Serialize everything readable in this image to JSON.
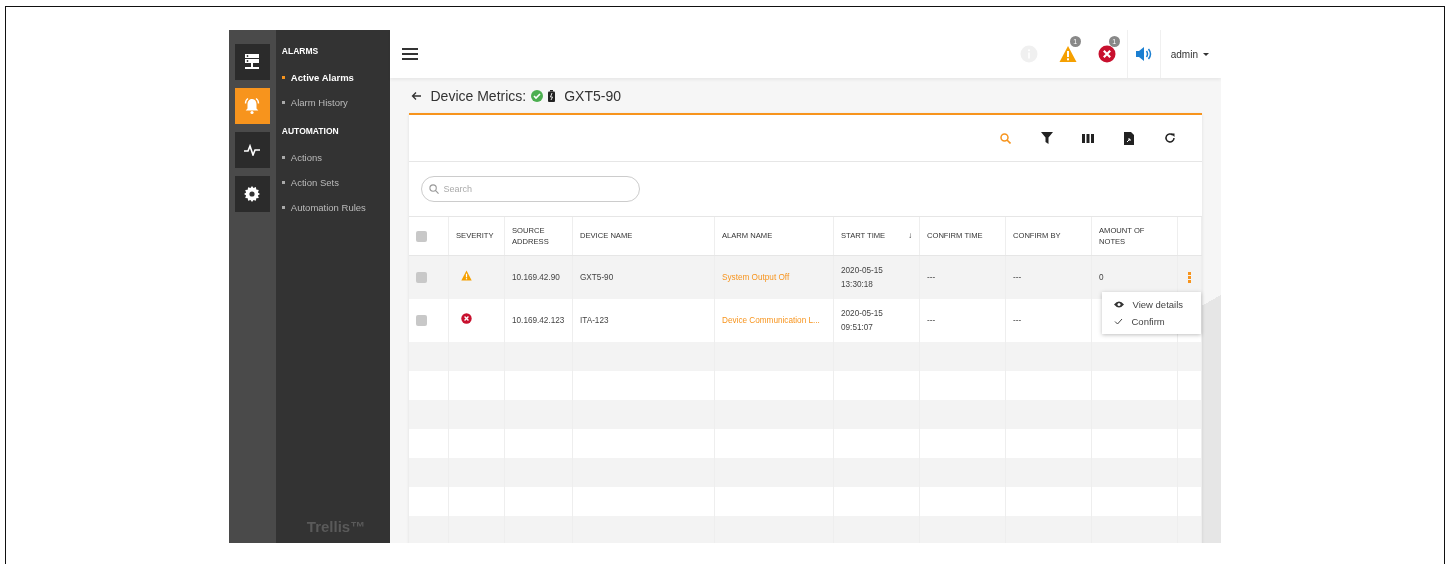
{
  "rail": [
    {
      "kind": "server",
      "selected": false
    },
    {
      "kind": "bell",
      "selected": true
    },
    {
      "kind": "pulse",
      "selected": false
    },
    {
      "kind": "gear",
      "selected": false
    }
  ],
  "nav": [
    {
      "heading": "ALARMS",
      "items": [
        {
          "label": "Active Alarms",
          "selected": true
        },
        {
          "label": "Alarm History",
          "selected": false
        }
      ]
    },
    {
      "heading": "AUTOMATION",
      "items": [
        {
          "label": "Actions",
          "selected": false
        },
        {
          "label": "Action Sets",
          "selected": false
        },
        {
          "label": "Automation Rules",
          "selected": false
        }
      ]
    }
  ],
  "brand": "Trellis™",
  "topbar": {
    "alerts": [
      {
        "kind": "info"
      },
      {
        "kind": "warning",
        "count": "1"
      },
      {
        "kind": "critical",
        "count": "1"
      }
    ],
    "user": "admin"
  },
  "page": {
    "title": "Device Metrics:",
    "device": "GXT5-90"
  },
  "toolbar": [
    {
      "kind": "search"
    },
    {
      "kind": "filter"
    },
    {
      "kind": "columns"
    },
    {
      "kind": "export"
    },
    {
      "kind": "refresh"
    }
  ],
  "search": {
    "placeholder": "Search"
  },
  "table": {
    "header_checked": false,
    "columns": [
      {
        "label": "SEVERITY"
      },
      {
        "label": "SOURCE ADDRESS"
      },
      {
        "label": "DEVICE NAME"
      },
      {
        "label": "ALARM NAME"
      },
      {
        "label": "START TIME",
        "sort": "↓"
      },
      {
        "label": "CONFIRM TIME"
      },
      {
        "label": "CONFIRM BY"
      },
      {
        "label": "AMOUNT OF NOTES"
      }
    ],
    "rows": [
      {
        "checked": false,
        "severity": {
          "kind": "warning"
        },
        "source": "10.169.42.90",
        "device": "GXT5-90",
        "alarm": "System Output Off",
        "start": "2020-05-15 13:30:18",
        "confirm_time": "---",
        "confirm_by": "---",
        "notes": "0",
        "menu": true
      },
      {
        "checked": false,
        "severity": {
          "kind": "critical"
        },
        "source": "10.169.42.123",
        "device": "ITA-123",
        "alarm": "Device Communication L...",
        "start": "2020-05-15 09:51:07",
        "confirm_time": "---",
        "confirm_by": "---",
        "menu": false
      }
    ]
  },
  "row_menu": [
    {
      "kind": "view",
      "label": "View details"
    },
    {
      "kind": "confirm",
      "label": "Confirm"
    }
  ]
}
